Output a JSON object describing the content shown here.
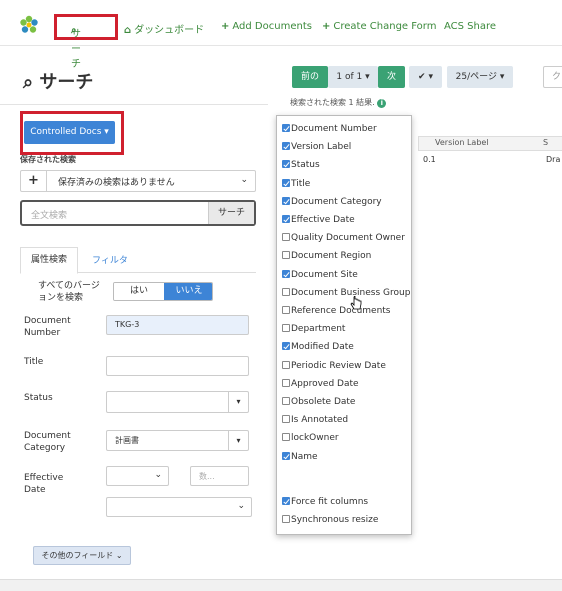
{
  "nav": {
    "search": "サーチ",
    "dashboard": "ダッシュボード",
    "add_documents": "Add Documents",
    "create_change_form": "Create Change Form",
    "acs_share": "ACS Share",
    "accent": "#3c8a3c"
  },
  "left": {
    "title": "サーチ",
    "controlled_docs": "Controlled Docs",
    "saved_label": "保存された検索",
    "saved_value": "保存済みの検索はありません",
    "search_placeholder": "全文検索",
    "search_button": "サーチ",
    "tab_attr": "属性検索",
    "tab_filter": "フィルタ",
    "all_versions_label": "すべてのバージョンを検索",
    "toggle_no": "はい",
    "toggle_yes": "いいえ",
    "doc_number_label": "Document Number",
    "doc_number_value": "TKG-3",
    "title_label": "Title",
    "status_label": "Status",
    "doc_category_label": "Document Category",
    "doc_category_value": "計画書",
    "effective_date_label": "Effective Date",
    "num_placeholder": "数...",
    "more_fields": "その他のフィールド"
  },
  "right": {
    "prev": "前の",
    "page": "1 of 1",
    "next": "次",
    "per_page": "25/ページ",
    "results": "検索された検索 1 結果.",
    "filter_placeholder": "ク",
    "col_version": "Version Label",
    "col_s": "S",
    "row_version": "0.1",
    "row_s": "Dra"
  },
  "columns": [
    {
      "label": "Document Number",
      "checked": true
    },
    {
      "label": "Version Label",
      "checked": true
    },
    {
      "label": "Status",
      "checked": true
    },
    {
      "label": "Title",
      "checked": true
    },
    {
      "label": "Document Category",
      "checked": true
    },
    {
      "label": "Effective Date",
      "checked": true
    },
    {
      "label": "Quality Document Owner",
      "checked": false
    },
    {
      "label": "Document Region",
      "checked": false
    },
    {
      "label": "Document Site",
      "checked": true
    },
    {
      "label": "Document Business Group",
      "checked": false
    },
    {
      "label": "Reference Documents",
      "checked": false
    },
    {
      "label": "Department",
      "checked": false
    },
    {
      "label": "Modified Date",
      "checked": true
    },
    {
      "label": "Periodic Review Date",
      "checked": false
    },
    {
      "label": "Approved Date",
      "checked": false
    },
    {
      "label": "Obsolete Date",
      "checked": false
    },
    {
      "label": "Is Annotated",
      "checked": false
    },
    {
      "label": "lockOwner",
      "checked": false
    },
    {
      "label": "Name",
      "checked": true
    }
  ],
  "options": [
    {
      "label": "Force fit columns",
      "checked": true
    },
    {
      "label": "Synchronous resize",
      "checked": false
    }
  ]
}
